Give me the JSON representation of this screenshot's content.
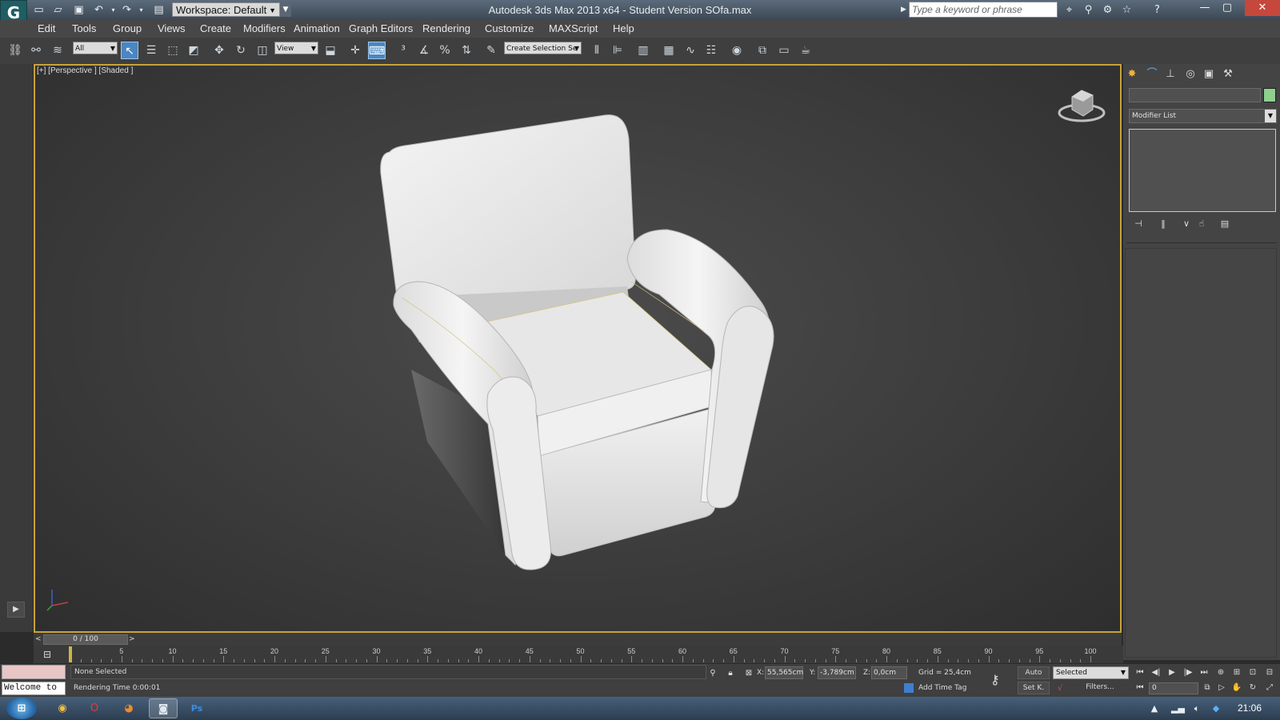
{
  "titlebar": {
    "workspace": "Workspace: Default",
    "title": "Autodesk 3ds Max  2013 x64  - Student Version     SOfa.max",
    "search_placeholder": "Type a keyword or phrase"
  },
  "menu": [
    "Edit",
    "Tools",
    "Group",
    "Views",
    "Create",
    "Modifiers",
    "Animation",
    "Graph Editors",
    "Rendering",
    "Customize",
    "MAXScript",
    "Help"
  ],
  "toolbar": {
    "selection_filter": "All",
    "reference_coord": "View",
    "named_selection": "Create Selection Se"
  },
  "viewport": {
    "label": "[+] [Perspective ] [Shaded ]"
  },
  "command_panel": {
    "modifier_list": "Modifier List",
    "swatch_color": "#8fd18e"
  },
  "timeline": {
    "slider": "0 / 100",
    "ticks": [
      "0",
      "5",
      "10",
      "15",
      "20",
      "25",
      "30",
      "35",
      "40",
      "45",
      "50",
      "55",
      "60",
      "65",
      "70",
      "75",
      "80",
      "85",
      "90",
      "95",
      "100"
    ]
  },
  "status": {
    "welcome": "Welcome to",
    "selection": "None Selected",
    "render_time": "Rendering Time  0:00:01",
    "x_label": "X:",
    "x_value": "55,565cm",
    "y_label": "Y:",
    "y_value": "-3,789cm",
    "z_label": "Z:",
    "z_value": "0,0cm",
    "grid": "Grid = 25,4cm",
    "add_time_tag": "Add Time Tag",
    "auto_key": "Auto",
    "set_key": "Set K.",
    "selected": "Selected",
    "filters": "Filters...",
    "frame": "0"
  },
  "taskbar": {
    "clock": "21:06"
  }
}
